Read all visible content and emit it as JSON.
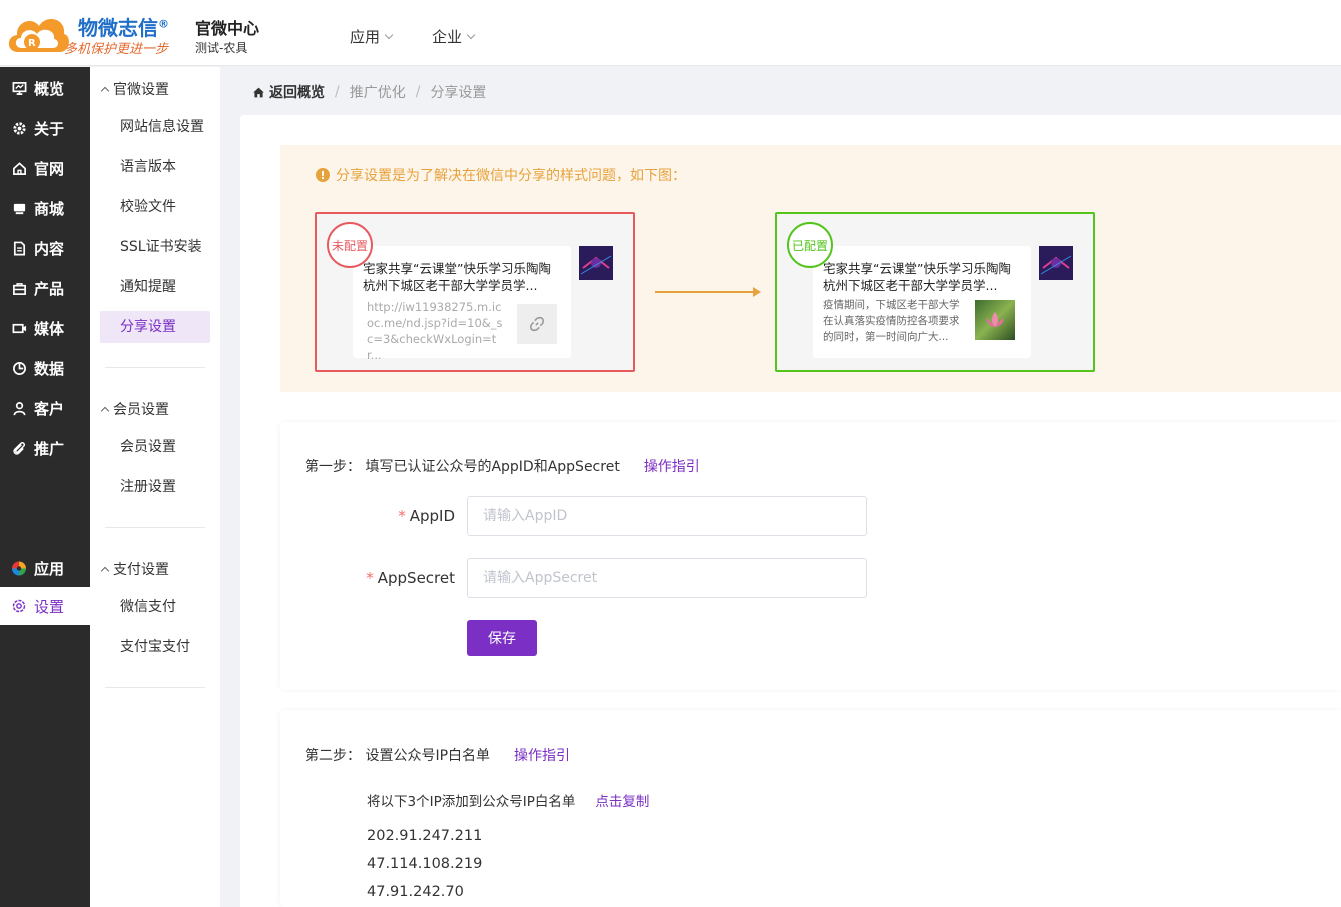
{
  "header": {
    "brand": "物微志信",
    "brand_mark": "®",
    "slogan": "多机保护更进一步",
    "center_title": "官微中心",
    "center_sub": "测试-农具",
    "nav": [
      {
        "label": "应用"
      },
      {
        "label": "企业"
      }
    ]
  },
  "sidebar": {
    "items": [
      {
        "label": "概览",
        "icon": "monitor-icon"
      },
      {
        "label": "关于",
        "icon": "gear-icon"
      },
      {
        "label": "官网",
        "icon": "home-icon"
      },
      {
        "label": "商城",
        "icon": "store-icon"
      },
      {
        "label": "内容",
        "icon": "document-icon"
      },
      {
        "label": "产品",
        "icon": "bag-icon"
      },
      {
        "label": "媒体",
        "icon": "video-icon"
      },
      {
        "label": "数据",
        "icon": "chart-pie-icon"
      },
      {
        "label": "客户",
        "icon": "user-icon"
      },
      {
        "label": "推广",
        "icon": "paperclip-icon"
      },
      {
        "label": "应用",
        "icon": "color-wheel-icon"
      },
      {
        "label": "设置",
        "icon": "settings-icon"
      }
    ]
  },
  "subnav": {
    "groups": [
      {
        "title": "官微设置",
        "items": [
          "网站信息设置",
          "语言版本",
          "校验文件",
          "SSL证书安装",
          "通知提醒",
          "分享设置"
        ]
      },
      {
        "title": "会员设置",
        "items": [
          "会员设置",
          "注册设置"
        ]
      },
      {
        "title": "支付设置",
        "items": [
          "微信支付",
          "支付宝支付"
        ]
      }
    ]
  },
  "breadcrumb": {
    "home": "返回概览",
    "sep": "/",
    "items": [
      "推广优化",
      "分享设置"
    ]
  },
  "notice": {
    "icon": "!",
    "text": "分享设置是为了解决在微信中分享的样式问题，如下图：",
    "bad_stamp": "未配置",
    "good_stamp": "已配置",
    "card_title": "宅家共享“云课堂”快乐学习乐陶陶杭州下城区老干部大学学员学...",
    "bad_url": "http://iw11938275.m.icoc.me/nd.jsp?id=10&_sc=3&checkWxLogin=tr...",
    "good_desc": "疫情期间，下城区老干部大学在认真落实疫情防控各项要求的同时，第一时间向广大..."
  },
  "step1": {
    "title": "第一步：  填写已认证公众号的AppID和AppSecret",
    "guide": "操作指引",
    "required_mark": "*",
    "appid_label": "AppID",
    "appid_placeholder": "请输入AppID",
    "appid_value": "",
    "secret_label": "AppSecret",
    "secret_placeholder": "请输入AppSecret",
    "secret_value": "",
    "save": "保存"
  },
  "step2": {
    "title": "第二步：  设置公众号IP白名单",
    "guide": "操作指引",
    "hint": "将以下3个IP添加到公众号IP白名单",
    "copy": "点击复制",
    "ips": [
      "202.91.247.211",
      "47.114.108.219",
      "47.91.242.70"
    ]
  },
  "colors": {
    "accent": "#7b2fc4",
    "warning": "#e6a23c",
    "danger": "#e8595f",
    "success": "#52c41a",
    "sidebar_bg": "#2b2b2b"
  }
}
